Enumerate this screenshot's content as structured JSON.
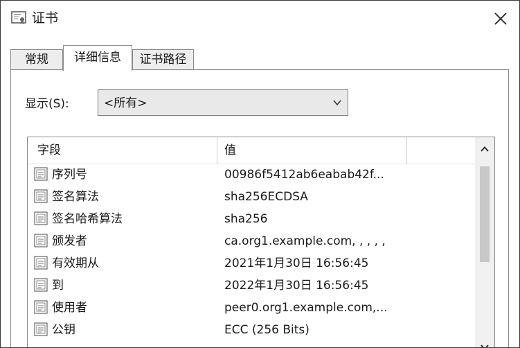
{
  "window": {
    "title": "证书"
  },
  "tabs": [
    {
      "label": "常规",
      "active": false
    },
    {
      "label": "详细信息",
      "active": true
    },
    {
      "label": "证书路径",
      "active": false
    }
  ],
  "show": {
    "label": "显示(S):",
    "selected": "<所有>"
  },
  "list": {
    "columns": [
      "字段",
      "值"
    ],
    "rows": [
      {
        "field": "序列号",
        "value": "00986f5412ab6eabab42f..."
      },
      {
        "field": "签名算法",
        "value": "sha256ECDSA"
      },
      {
        "field": "签名哈希算法",
        "value": "sha256"
      },
      {
        "field": "颁发者",
        "value": "ca.org1.example.com, , , , ,"
      },
      {
        "field": "有效期从",
        "value": "2021年1月30日 16:56:45"
      },
      {
        "field": "到",
        "value": "2022年1月30日 16:56:45"
      },
      {
        "field": "使用者",
        "value": "peer0.org1.example.com,..."
      },
      {
        "field": "公钥",
        "value": "ECC (256 Bits)"
      }
    ]
  },
  "icons": {
    "window": "certificate-icon",
    "close": "close-icon",
    "row": "certificate-field-icon",
    "dropdown": "chevron-down-icon"
  }
}
